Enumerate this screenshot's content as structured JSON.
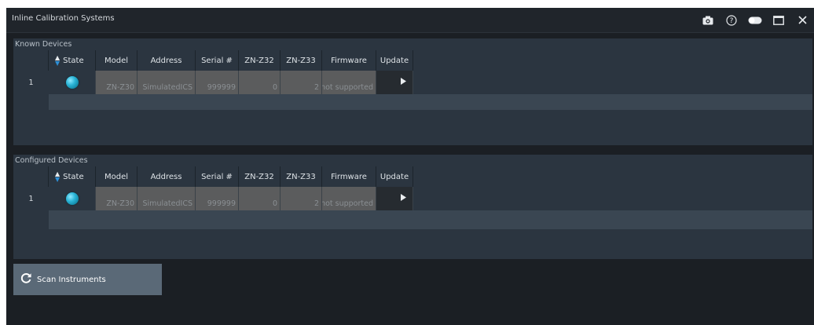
{
  "window": {
    "title": "Inline Calibration Systems",
    "icons": [
      "camera-icon",
      "help-icon",
      "toggle-icon",
      "maximize-icon",
      "close-icon"
    ]
  },
  "columns": [
    "State",
    "Model",
    "Address",
    "Serial #",
    "ZN-Z32",
    "ZN-Z33",
    "Firmware",
    "Update"
  ],
  "known_devices": {
    "heading": "Known Devices",
    "rows": [
      {
        "index": "1",
        "model": "ZN-Z30",
        "address": "SimulatedICS",
        "serial": "999999",
        "z32": "0",
        "z33": "2",
        "firmware": "not supported"
      }
    ]
  },
  "configured_devices": {
    "heading": "Configured Devices",
    "rows": [
      {
        "index": "1",
        "model": "ZN-Z30",
        "address": "SimulatedICS",
        "serial": "999999",
        "z32": "0",
        "z33": "2",
        "firmware": "not supported"
      }
    ]
  },
  "scan_button": {
    "label": "Scan Instruments"
  },
  "colors": {
    "background": "#1b1f24",
    "panel": "#2b3540",
    "cell_readonly": "#5b5c5d",
    "accent": "#2d8fd6",
    "button": "#5a6977"
  }
}
